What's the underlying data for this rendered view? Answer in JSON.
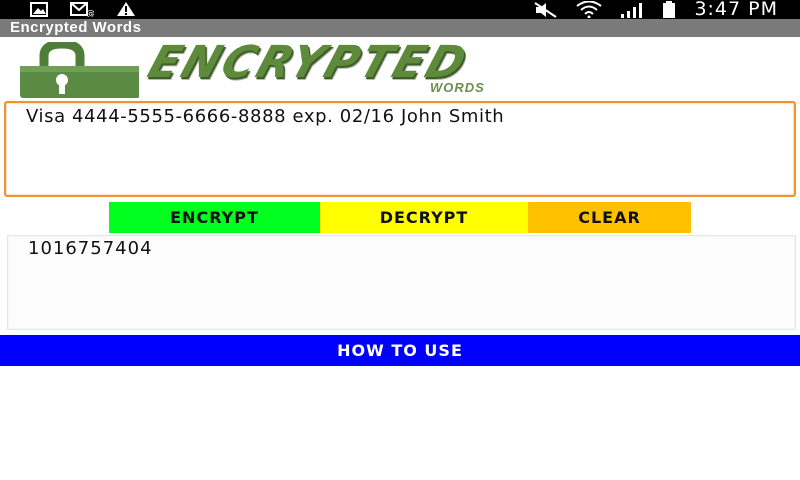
{
  "status_bar": {
    "time": "3:47 PM",
    "icons": [
      "gallery-icon",
      "email-icon",
      "warning-icon",
      "mute-icon",
      "wifi-icon",
      "signal-icon",
      "battery-icon"
    ]
  },
  "app": {
    "title": "Encrypted Words"
  },
  "logo": {
    "wordmark": "ENCRYPTED",
    "subtitle": "WORDS",
    "accent_color": "#5e8a3c"
  },
  "input": {
    "value": "Visa 4444-5555-6666-8888 exp. 02/16 John Smith",
    "border_color": "#f0932b"
  },
  "buttons": {
    "encrypt": {
      "label": "ENCRYPT",
      "color": "#00ff1e"
    },
    "decrypt": {
      "label": "DECRYPT",
      "color": "#ffff00"
    },
    "clear": {
      "label": "CLEAR",
      "color": "#ffc000"
    }
  },
  "output": {
    "value": "1016757404"
  },
  "how_to_use": {
    "label": "HOW TO USE",
    "color": "#0000ff"
  }
}
